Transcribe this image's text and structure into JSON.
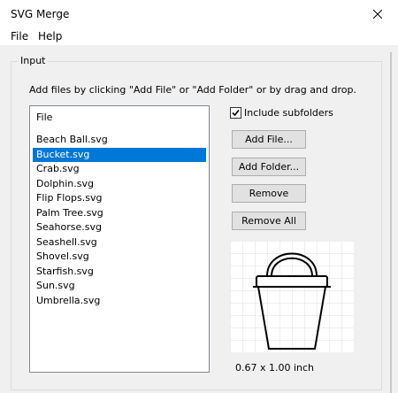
{
  "window": {
    "title": "SVG Merge"
  },
  "menu": [
    "File",
    "Help"
  ],
  "input_group": {
    "legend": "Input",
    "instructions": "Add files by clicking \"Add File\" or \"Add Folder\" or by drag and drop."
  },
  "file_list": {
    "header": "File",
    "items": [
      "Beach Ball.svg",
      "Bucket.svg",
      "Crab.svg",
      "Dolphin.svg",
      "Flip Flops.svg",
      "Palm Tree.svg",
      "Seahorse.svg",
      "Seashell.svg",
      "Shovel.svg",
      "Starfish.svg",
      "Sun.svg",
      "Umbrella.svg"
    ],
    "selected_index": 1
  },
  "options": {
    "include_subfolders_label": "Include subfolders",
    "include_subfolders_checked": true
  },
  "buttons": {
    "add_file": "Add File...",
    "add_folder": "Add Folder...",
    "remove": "Remove",
    "remove_all": "Remove All"
  },
  "preview": {
    "dimensions": "0.67 x 1.00 inch"
  },
  "colors": {
    "selection": "#0078d7",
    "background": "#f0f0f0"
  }
}
